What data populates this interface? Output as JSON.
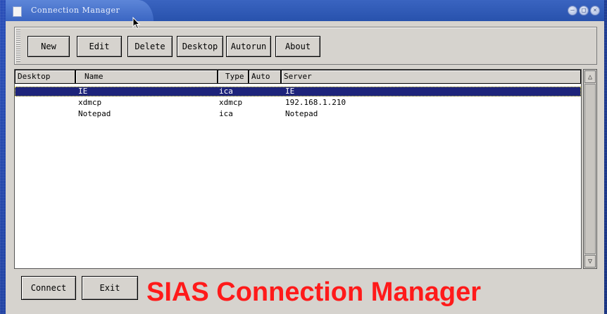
{
  "window": {
    "title": "Connection Manager",
    "controls": {
      "minimize": "–",
      "maximize": "□",
      "close": "×"
    }
  },
  "toolbar": {
    "buttons": [
      {
        "label": "New"
      },
      {
        "label": "Edit"
      },
      {
        "label": "Delete"
      },
      {
        "label": "Desktop"
      },
      {
        "label": "Autorun"
      },
      {
        "label": "About"
      }
    ]
  },
  "list": {
    "columns": [
      "Desktop",
      "Name",
      "Type",
      "Auto",
      "Server"
    ],
    "rows": [
      {
        "desktop": "",
        "name": "IE",
        "type": "ica",
        "auto": "",
        "server": "IE",
        "selected": true
      },
      {
        "desktop": "",
        "name": "xdmcp",
        "type": "xdmcp",
        "auto": "",
        "server": "192.168.1.210",
        "selected": false
      },
      {
        "desktop": "",
        "name": "Notepad",
        "type": "ica",
        "auto": "",
        "server": "Notepad",
        "selected": false
      }
    ]
  },
  "scrollbar": {
    "up": "△",
    "down": "▽"
  },
  "bottom": {
    "connect_label": "Connect",
    "exit_label": "Exit",
    "banner": "SIAS Connection Manager"
  },
  "colors": {
    "desktop_bg": "#1d3c9a",
    "titlebar": "#2852ad",
    "selection": "#1e247b",
    "banner": "#ff1a1a"
  },
  "icons": [
    "window-icon",
    "minimize-icon",
    "maximize-icon",
    "close-icon",
    "cursor-icon",
    "scroll-up-icon",
    "scroll-down-icon"
  ]
}
